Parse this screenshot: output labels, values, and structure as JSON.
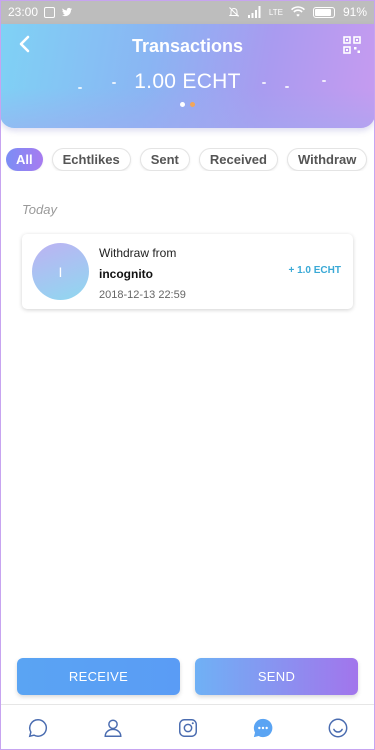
{
  "status_bar": {
    "time": "23:00",
    "battery": "91%",
    "network": "LTE"
  },
  "header": {
    "title": "Transactions",
    "balance": "1.00 ECHT"
  },
  "filters": [
    {
      "label": "All",
      "active": true
    },
    {
      "label": "Echtlikes",
      "active": false
    },
    {
      "label": "Sent",
      "active": false
    },
    {
      "label": "Received",
      "active": false
    },
    {
      "label": "Withdraw",
      "active": false
    }
  ],
  "section": {
    "label": "Today"
  },
  "transaction": {
    "avatar_initial": "I",
    "type": "Withdraw from",
    "name": "incognito",
    "date": "2018-12-13 22:59",
    "amount": "+ 1.0 ECHT"
  },
  "actions": {
    "receive_label": "RECEIVE",
    "send_label": "SEND"
  },
  "tabbar": {
    "icons": [
      "chat-icon",
      "profile-icon",
      "instagram-icon",
      "messages-icon",
      "smile-icon"
    ],
    "active_color": "#5aa4f3"
  },
  "colors": {
    "accent": "#7b8ef5",
    "amount": "#3aa9d6"
  }
}
